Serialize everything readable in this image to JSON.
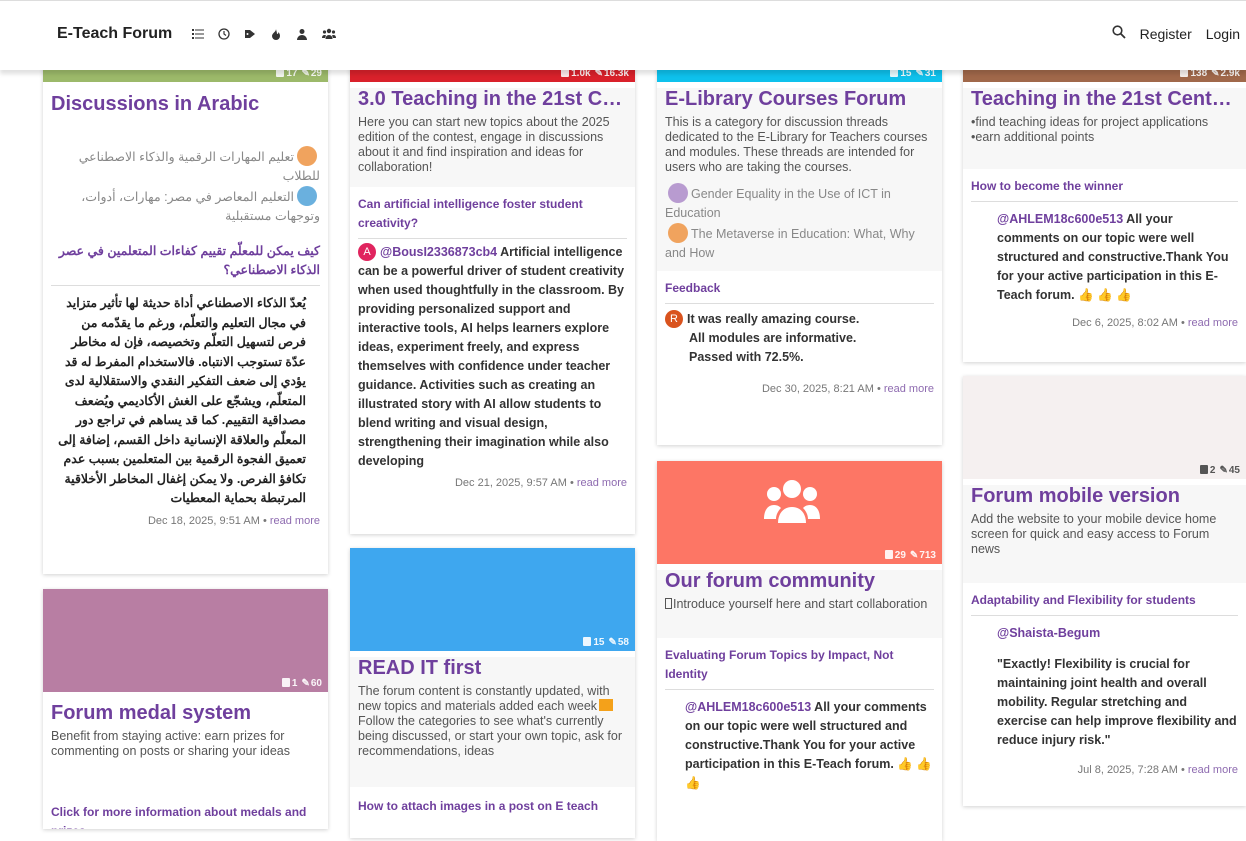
{
  "header": {
    "brand": "E-Teach Forum",
    "nav_icons": [
      "list-icon",
      "clock-icon",
      "tags-icon",
      "fire-icon",
      "user-icon",
      "users-icon"
    ],
    "search_icon": "search-icon",
    "register": "Register",
    "login": "Login"
  },
  "cards": {
    "arabic": {
      "color": "#9cb96a",
      "topics": "17",
      "posts": "29",
      "title": "Discussions in Arabic",
      "sub1": "تعليم المهارات الرقمية والذكاء الاصطناعي للطلاب",
      "sub2": "التعليم المعاصر في مصر: مهارات، أدوات، وتوجهات مستقبلية",
      "latest_title": "كيف يمكن للمعلّم تقييم كفاءات المتعلمين في عصر الذكاء الاصطناعي؟",
      "latest_body": "يُعدّ الذكاء الاصطناعي أداة حديثة لها تأثير متزايد في مجال التعليم والتعلّم، ورغم ما يقدّمه من فرص لتسهيل التعلّم وتخصيصه، فإن له مخاطر عدّة تستوجب الانتباه. فالاستخدام المفرط له قد يؤدي إلى ضعف التفكير النقدي والاستقلالية لدى المتعلّم، ويشجّع على الغش الأكاديمي ويُضعف مصداقية التقييم. كما قد يساهم في تراجع دور المعلّم والعلاقة الإنسانية داخل القسم، إضافة إلى تعميق الفجوة الرقمية بين المتعلمين بسبب عدم تكافؤ الفرص. ولا يمكن إغفال المخاطر الأخلاقية المرتبطة بحماية المعطيات",
      "date": "Dec 18, 2025, 9:51 AM",
      "read_more": "read more"
    },
    "medal": {
      "color": "#b87ea3",
      "topics": "1",
      "posts": "60",
      "title": "Forum medal system",
      "desc": "Benefit from staying active: earn prizes for commenting on posts or sharing your ideas",
      "latest_title": "Click for more information about medals and prizes"
    },
    "teaching30": {
      "color": "#d9212b",
      "topics": "1.0k",
      "posts": "16.3k",
      "title": "3.0 Teaching in the 21st Ce...",
      "desc": "Here you can start new topics about the 2025 edition of the contest, engage in discussions about it and find inspiration and ideas for collaboration!",
      "latest_title": "Can artificial intelligence foster student creativity?",
      "avatar_letter": "A",
      "avatar_color": "#e0245e",
      "user": "@BousI2336873cb4",
      "latest_body": "Artificial intelligence can be a powerful driver of student creativity when used thoughtfully in the classroom. By providing personalized support and interactive tools, AI helps learners explore ideas, experiment freely, and express themselves with confidence under teacher guidance. Activities such as creating an illustrated story with AI allow students to blend writing and visual design, strengthening their imagination while also developing",
      "date": "Dec 21, 2025, 9:57 AM",
      "read_more": "read more"
    },
    "readit": {
      "color": "#3ea7ef",
      "topics": "15",
      "posts": "58",
      "title": "READ IT first",
      "desc1": "The forum content is constantly updated, with new topics and materials added each week",
      "desc2": "Follow the categories to see what's currently being discussed, or start your own topic, ask for recommendations, ideas",
      "latest_title": "How to attach images in a post on E teach"
    },
    "elibrary": {
      "color": "#0ec1ec",
      "topics": "15",
      "posts": "31",
      "title": "E-Library Courses Forum",
      "desc": "This is a category for discussion threads dedicated to the E-Library for Teachers courses and modules. These threads are intended for users who are taking the courses.",
      "sub1": "Gender Equality in the Use of ICT in Education",
      "sub2": "The Metaverse in Education: What, Why and How",
      "latest_title": "Feedback",
      "avatar_letter": "R",
      "avatar_color": "#d9531e",
      "line1": "It was really amazing course.",
      "line2": "All modules are informative.",
      "line3": "Passed with 72.5%.",
      "date": "Dec 30, 2025, 8:21 AM",
      "read_more": "read more"
    },
    "community": {
      "color": "#fd7665",
      "topics": "29",
      "posts": "713",
      "title": "Our forum community",
      "desc": "Introduce yourself here and start collaboration",
      "latest_title": "Evaluating Forum Topics by Impact, Not Identity",
      "user": "@AHLEM18c600e513",
      "latest_body": "All your comments on our topic were well structured and constructive.Thank You for your active participation in this E-Teach forum."
    },
    "teaching21": {
      "color": "#a0684a",
      "topics": "138",
      "posts": "2.9k",
      "title": "Teaching in the 21st Centur...",
      "desc1": "•find teaching ideas for project applications",
      "desc2": "•earn additional points",
      "latest_title": "How to become the winner",
      "user": "@AHLEM18c600e513",
      "latest_body": "All your comments on our topic were well structured and constructive.Thank You for your active participation in this E-Teach forum.",
      "date": "Dec 6, 2025, 8:02 AM",
      "read_more": "read more"
    },
    "mobile": {
      "color": "#f5f0f0",
      "topics": "2",
      "posts": "45",
      "title": "Forum mobile version",
      "desc": "Add the website to your mobile device home screen for quick and easy access to Forum news",
      "latest_title": "Adaptability and Flexibility for students",
      "user": "@Shaista-Begum",
      "latest_body": "\"Exactly! Flexibility is crucial for maintaining joint health and overall mobility. Regular stretching and exercise can help improve flexibility and reduce injury risk.\"",
      "date": "Jul 8, 2025, 7:28 AM",
      "read_more": "read more"
    }
  }
}
